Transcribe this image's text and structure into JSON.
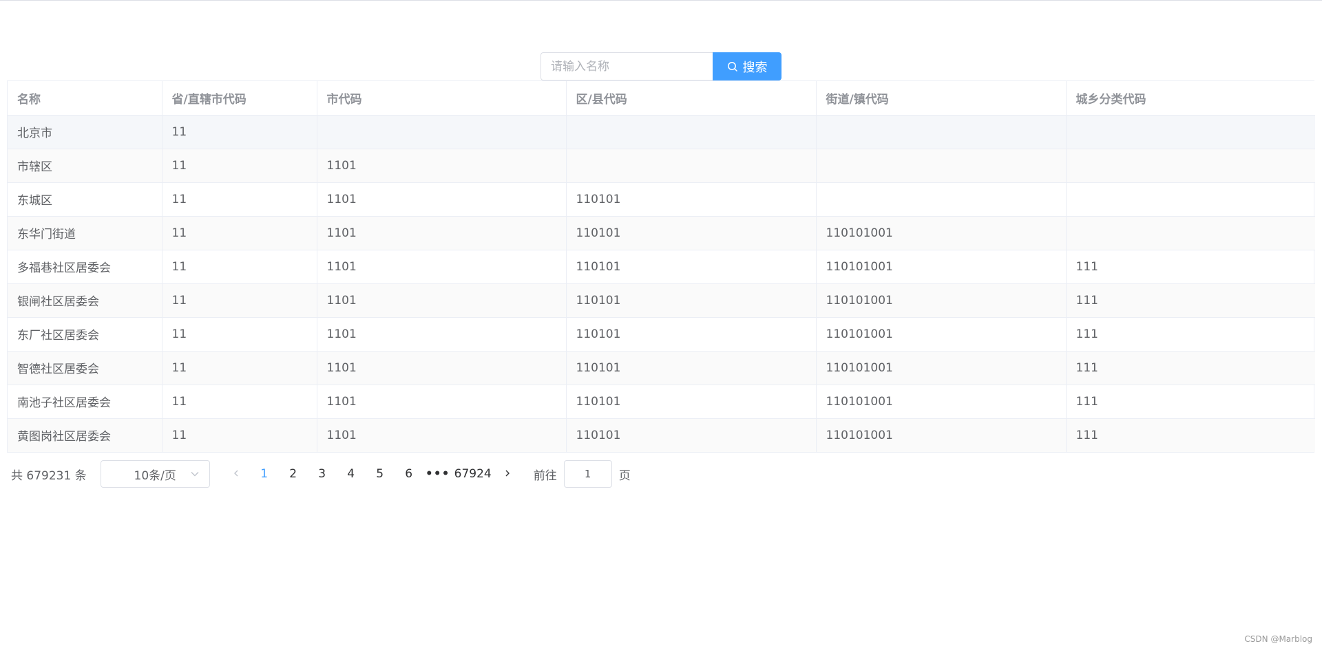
{
  "search": {
    "placeholder": "请输入名称",
    "value": "",
    "button_label": "搜索"
  },
  "table": {
    "columns": [
      "名称",
      "省/直辖市代码",
      "市代码",
      "区/县代码",
      "街道/镇代码",
      "城乡分类代码"
    ],
    "rows": [
      [
        "北京市",
        "11",
        "",
        "",
        "",
        ""
      ],
      [
        "市辖区",
        "11",
        "1101",
        "",
        "",
        ""
      ],
      [
        "东城区",
        "11",
        "1101",
        "110101",
        "",
        ""
      ],
      [
        "东华门街道",
        "11",
        "1101",
        "110101",
        "110101001",
        ""
      ],
      [
        "多福巷社区居委会",
        "11",
        "1101",
        "110101",
        "110101001",
        "111"
      ],
      [
        "银闸社区居委会",
        "11",
        "1101",
        "110101",
        "110101001",
        "111"
      ],
      [
        "东厂社区居委会",
        "11",
        "1101",
        "110101",
        "110101001",
        "111"
      ],
      [
        "智德社区居委会",
        "11",
        "1101",
        "110101",
        "110101001",
        "111"
      ],
      [
        "南池子社区居委会",
        "11",
        "1101",
        "110101",
        "110101001",
        "111"
      ],
      [
        "黄图岗社区居委会",
        "11",
        "1101",
        "110101",
        "110101001",
        "111"
      ]
    ]
  },
  "pagination": {
    "total_text": "共 679231 条",
    "page_size": "10条/页",
    "pages": [
      "1",
      "2",
      "3",
      "4",
      "5",
      "6"
    ],
    "current_page": "1",
    "more": "•••",
    "last_page": "67924",
    "goto_label": "前往",
    "goto_value": "1",
    "page_suffix": "页"
  },
  "watermark": "CSDN @Marblog",
  "colors": {
    "primary": "#409eff",
    "border": "#dcdfe6",
    "header_text": "#909399",
    "body_text": "#606266"
  },
  "icons": {
    "search_button": "search-icon",
    "page_size": "chevron-down-icon",
    "prev": "chevron-left-icon",
    "next": "chevron-right-icon"
  }
}
